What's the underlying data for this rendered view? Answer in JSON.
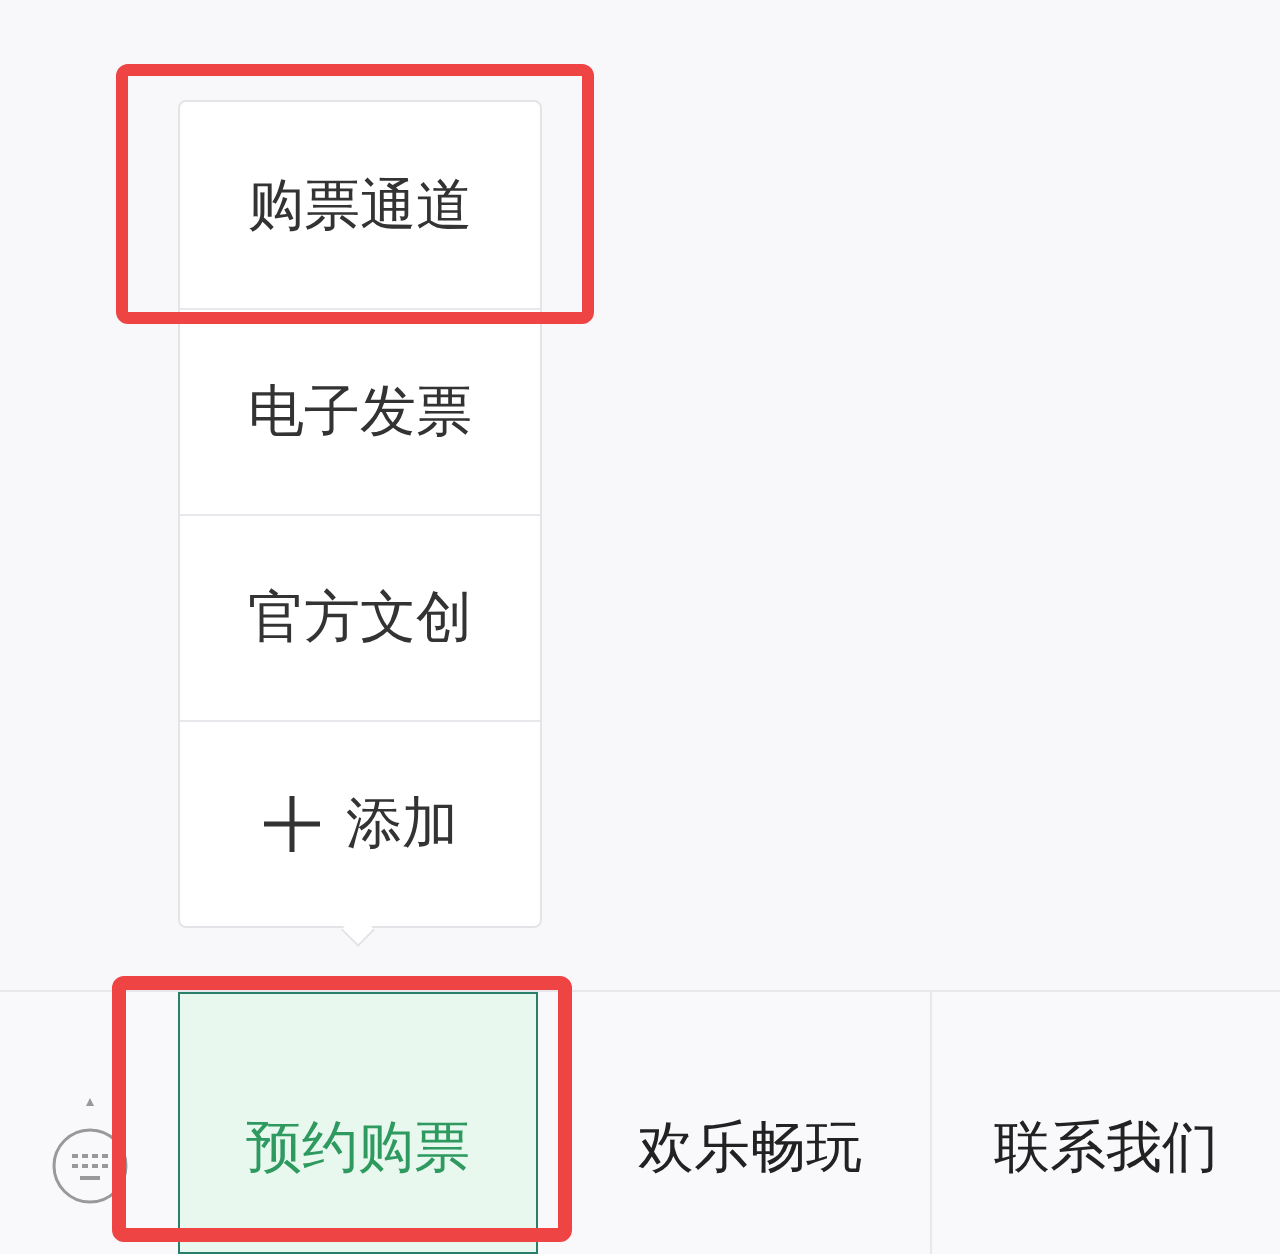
{
  "submenu": [
    {
      "kind": "item",
      "label": "购票通道",
      "highlighted": true
    },
    {
      "kind": "item",
      "label": "电子发票",
      "highlighted": false
    },
    {
      "kind": "item",
      "label": "官方文创",
      "highlighted": false
    },
    {
      "kind": "add",
      "label": "添加",
      "highlighted": false
    }
  ],
  "menu": [
    {
      "label": "预约购票",
      "selected": true,
      "highlighted": true
    },
    {
      "label": "欢乐畅玩",
      "selected": false,
      "highlighted": false
    },
    {
      "label": "联系我们",
      "selected": false,
      "highlighted": false
    }
  ]
}
